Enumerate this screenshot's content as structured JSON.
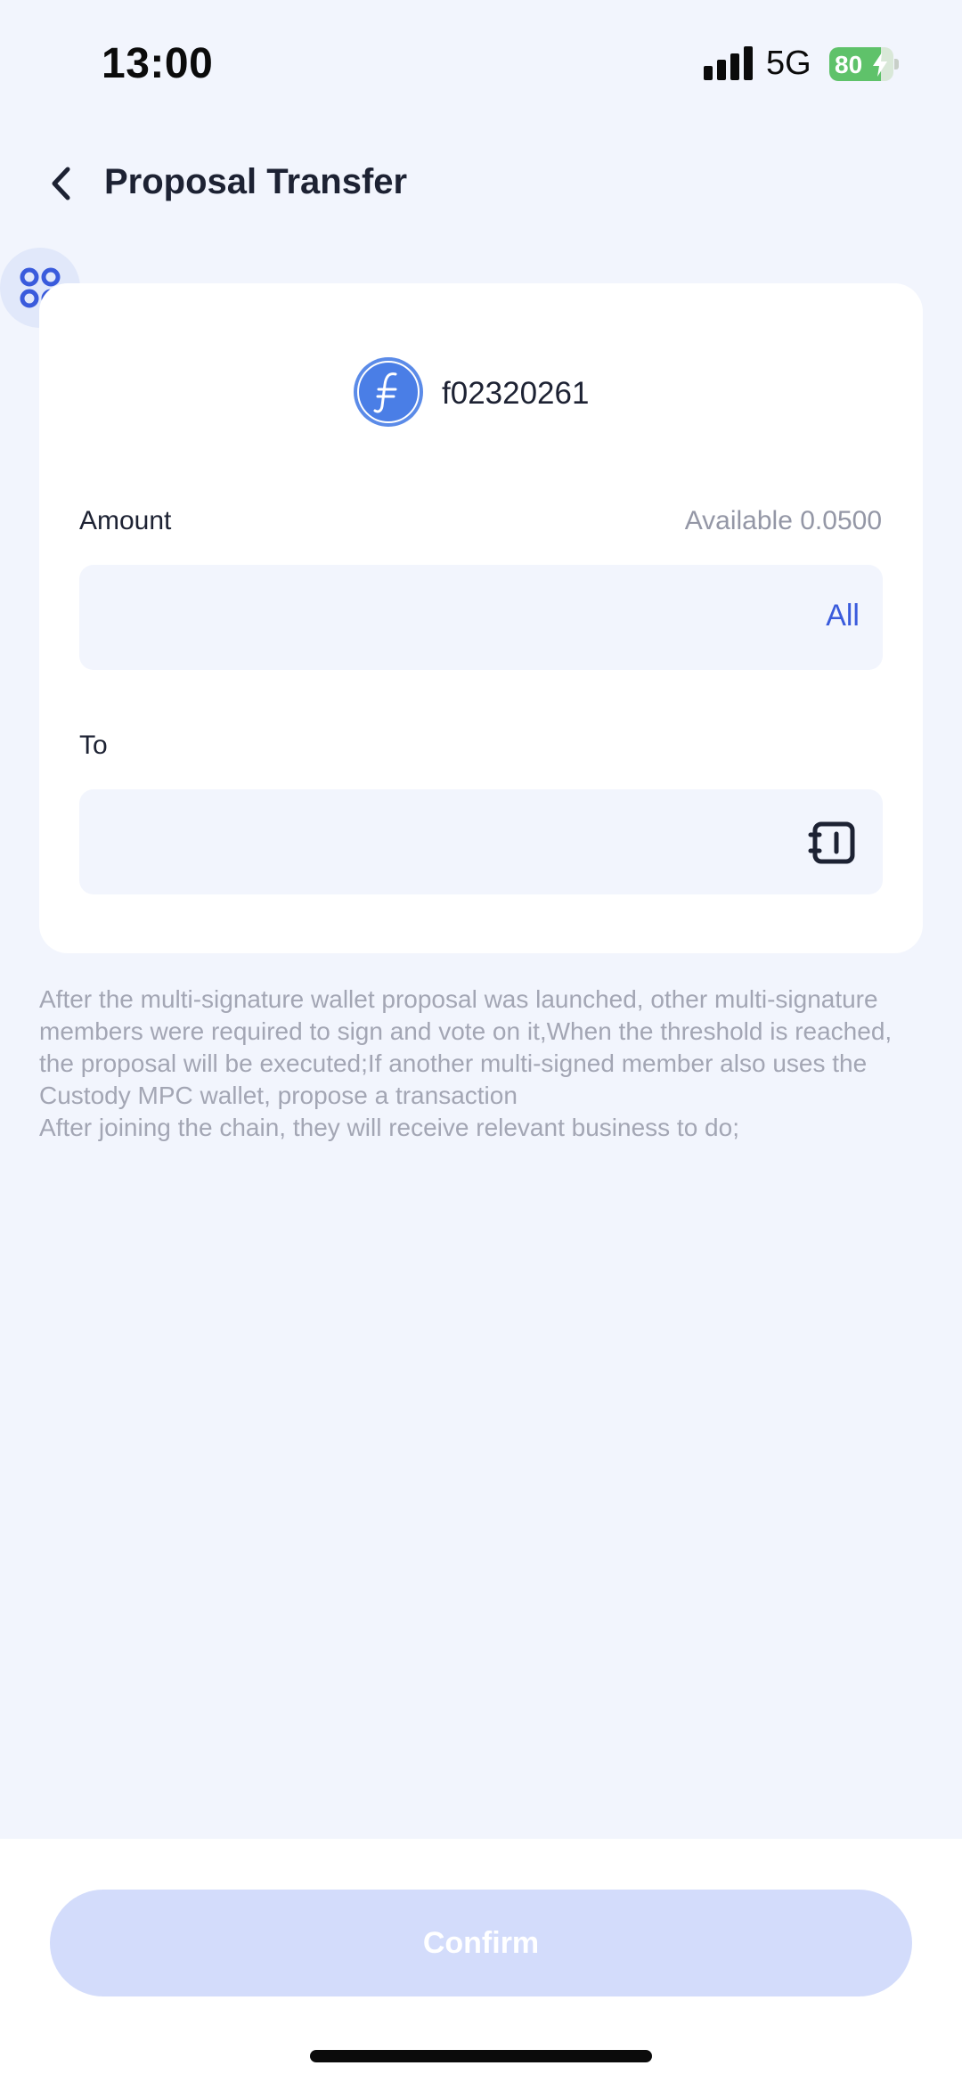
{
  "status_bar": {
    "time": "13:00",
    "network": "5G",
    "battery_level": 80,
    "battery_text": "80",
    "signal_icon": "cellular-signal-icon",
    "battery_icon": "battery-charging-icon"
  },
  "nav": {
    "title": "Proposal Transfer",
    "back_icon": "chevron-left-icon"
  },
  "floating_menu": {
    "icon": "grid-menu-icon"
  },
  "asset": {
    "name": "f02320261",
    "icon": "filecoin-logo-icon"
  },
  "amount": {
    "label": "Amount",
    "available": "Available 0.0500",
    "value": "",
    "all_label": "All"
  },
  "to": {
    "label": "To",
    "value": "",
    "address_book_icon": "address-book-icon"
  },
  "notice": {
    "lines": [
      "After the multi-signature wallet proposal was launched, other multi-signature members were required to sign and vote on it,When the threshold is reached, the proposal will be executed;If another multi-signed member also uses the Custody MPC wallet, propose a transaction",
      "After joining the chain, they will receive relevant business to do;"
    ]
  },
  "footer": {
    "confirm_label": "Confirm"
  },
  "colors": {
    "background": "#f2f5fd",
    "card": "#ffffff",
    "accent": "#3a5bdc",
    "confirm_disabled": "#d3dcfb",
    "muted_text": "#a3a6b4",
    "battery_green": "#5fc26a"
  }
}
